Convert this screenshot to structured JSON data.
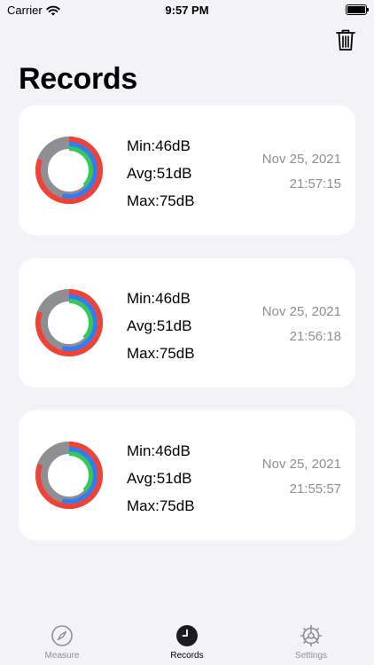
{
  "status_bar": {
    "carrier": "Carrier",
    "time": "9:57 PM"
  },
  "header": {
    "title": "Records",
    "trash_icon": "trash-icon"
  },
  "records": [
    {
      "min": "Min:46dB",
      "avg": "Avg:51dB",
      "max": "Max:75dB",
      "date": "Nov 25, 2021",
      "time": "21:57:15"
    },
    {
      "min": "Min:46dB",
      "avg": "Avg:51dB",
      "max": "Max:75dB",
      "date": "Nov 25, 2021",
      "time": "21:56:18"
    },
    {
      "min": "Min:46dB",
      "avg": "Avg:51dB",
      "max": "Max:75dB",
      "date": "Nov 25, 2021",
      "time": "21:55:57"
    }
  ],
  "ring_colors": {
    "max": "#f04236",
    "avg": "#2f7df5",
    "min": "#35c759",
    "track": "#8e8e93"
  },
  "tabs": [
    {
      "label": "Measure",
      "icon": "compass-icon"
    },
    {
      "label": "Records",
      "icon": "clock-icon"
    },
    {
      "label": "Settings",
      "icon": "gear-icon"
    }
  ],
  "active_tab": "Records"
}
